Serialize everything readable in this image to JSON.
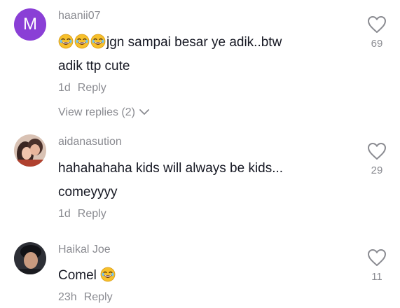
{
  "comments": [
    {
      "avatar_letter": "M",
      "username": "haanii07",
      "text_line1": "jgn sampai besar ye adik..btw",
      "text_line2": "adik ttp cute",
      "time": "1d",
      "reply_label": "Reply",
      "view_replies": "View replies (2)",
      "likes": "69"
    },
    {
      "username": "aidanasution",
      "text_line1": "hahahahaha kids will always be kids...",
      "text_line2": "comeyyyy",
      "time": "1d",
      "reply_label": "Reply",
      "likes": "29"
    },
    {
      "username": "Haikal Joe",
      "text_line1": "Comel",
      "time": "23h",
      "reply_label": "Reply",
      "likes": "11"
    }
  ],
  "colors": {
    "text": "#161823",
    "muted": "#8a8b91",
    "avatar_m": "#8a3fd6",
    "emoji": "#f7c02b"
  },
  "icons": [
    "laughing-emoji-icon",
    "heart-outline-icon",
    "chevron-down-icon"
  ]
}
